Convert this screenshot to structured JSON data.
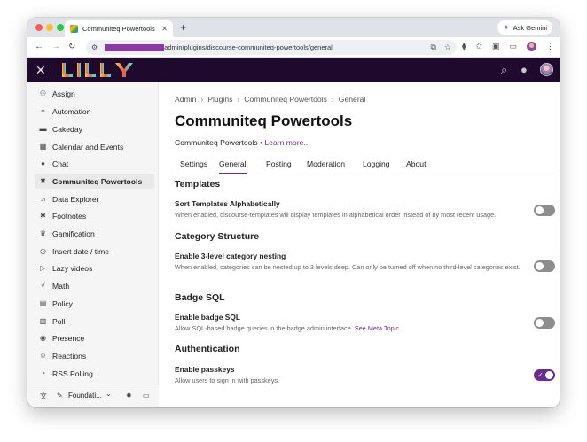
{
  "browser": {
    "tab_title": "Communiteq Powertools - Pl",
    "new_tab": "+",
    "ask_gemini": "Ask Gemini",
    "url": "admin/plugins/discourse-communiteq-powertools/general"
  },
  "sidebar": {
    "items": [
      {
        "label": "Assign",
        "icon": "user-plus-icon"
      },
      {
        "label": "Automation",
        "icon": "wand-icon"
      },
      {
        "label": "Cakeday",
        "icon": "cake-icon"
      },
      {
        "label": "Calendar and Events",
        "icon": "calendar-icon"
      },
      {
        "label": "Chat",
        "icon": "chat-bubble-icon"
      },
      {
        "label": "Communiteq Powertools",
        "icon": "tools-icon",
        "active": true
      },
      {
        "label": "Data Explorer",
        "icon": "chart-icon"
      },
      {
        "label": "Footnotes",
        "icon": "asterisk-icon"
      },
      {
        "label": "Gamification",
        "icon": "trophy-icon"
      },
      {
        "label": "Insert date / time",
        "icon": "clock-icon"
      },
      {
        "label": "Lazy videos",
        "icon": "play-icon"
      },
      {
        "label": "Math",
        "icon": "sqrt-icon"
      },
      {
        "label": "Policy",
        "icon": "document-icon"
      },
      {
        "label": "Poll",
        "icon": "bar-chart-icon"
      },
      {
        "label": "Presence",
        "icon": "eye-icon"
      },
      {
        "label": "Reactions",
        "icon": "smile-icon"
      },
      {
        "label": "RSS Polling",
        "icon": "rss-icon"
      }
    ],
    "footer": {
      "theme_label": "Foundati...",
      "chevron": "⌄"
    }
  },
  "main": {
    "breadcrumb": [
      "Admin",
      "Plugins",
      "Communiteq Powertools",
      "General"
    ],
    "title": "Communiteq Powertools",
    "subtitle": "Communiteq Powertools •",
    "learn_more": "Learn more...",
    "tabs": [
      "Settings",
      "General",
      "Posting",
      "Moderation",
      "Logging",
      "About"
    ],
    "active_tab": "General",
    "sections": [
      {
        "heading": "Templates",
        "setting": "Sort Templates Alphabetically",
        "description": "When enabled, discourse-templates will display templates in alphabetical order instead of by most recent usage.",
        "enabled": false
      },
      {
        "heading": "Category Structure",
        "setting": "Enable 3-level category nesting",
        "description": "When enabled, categories can be nested up to 3 levels deep. Can only be turned off when no third-level categories exist.",
        "enabled": false
      },
      {
        "heading": "Badge SQL",
        "setting": "Enable badge SQL",
        "description": "Allow SQL-based badge queries in the badge admin interface.",
        "link": "See Meta Topic.",
        "enabled": false
      },
      {
        "heading": "Authentication",
        "setting": "Enable passkeys",
        "description": "Allow users to sign in with passkeys.",
        "enabled": true
      }
    ]
  },
  "colors": {
    "accent": "#6b2d8e",
    "header_bg": "#1f0a2e",
    "toggle_off": "#8d8d8d"
  }
}
